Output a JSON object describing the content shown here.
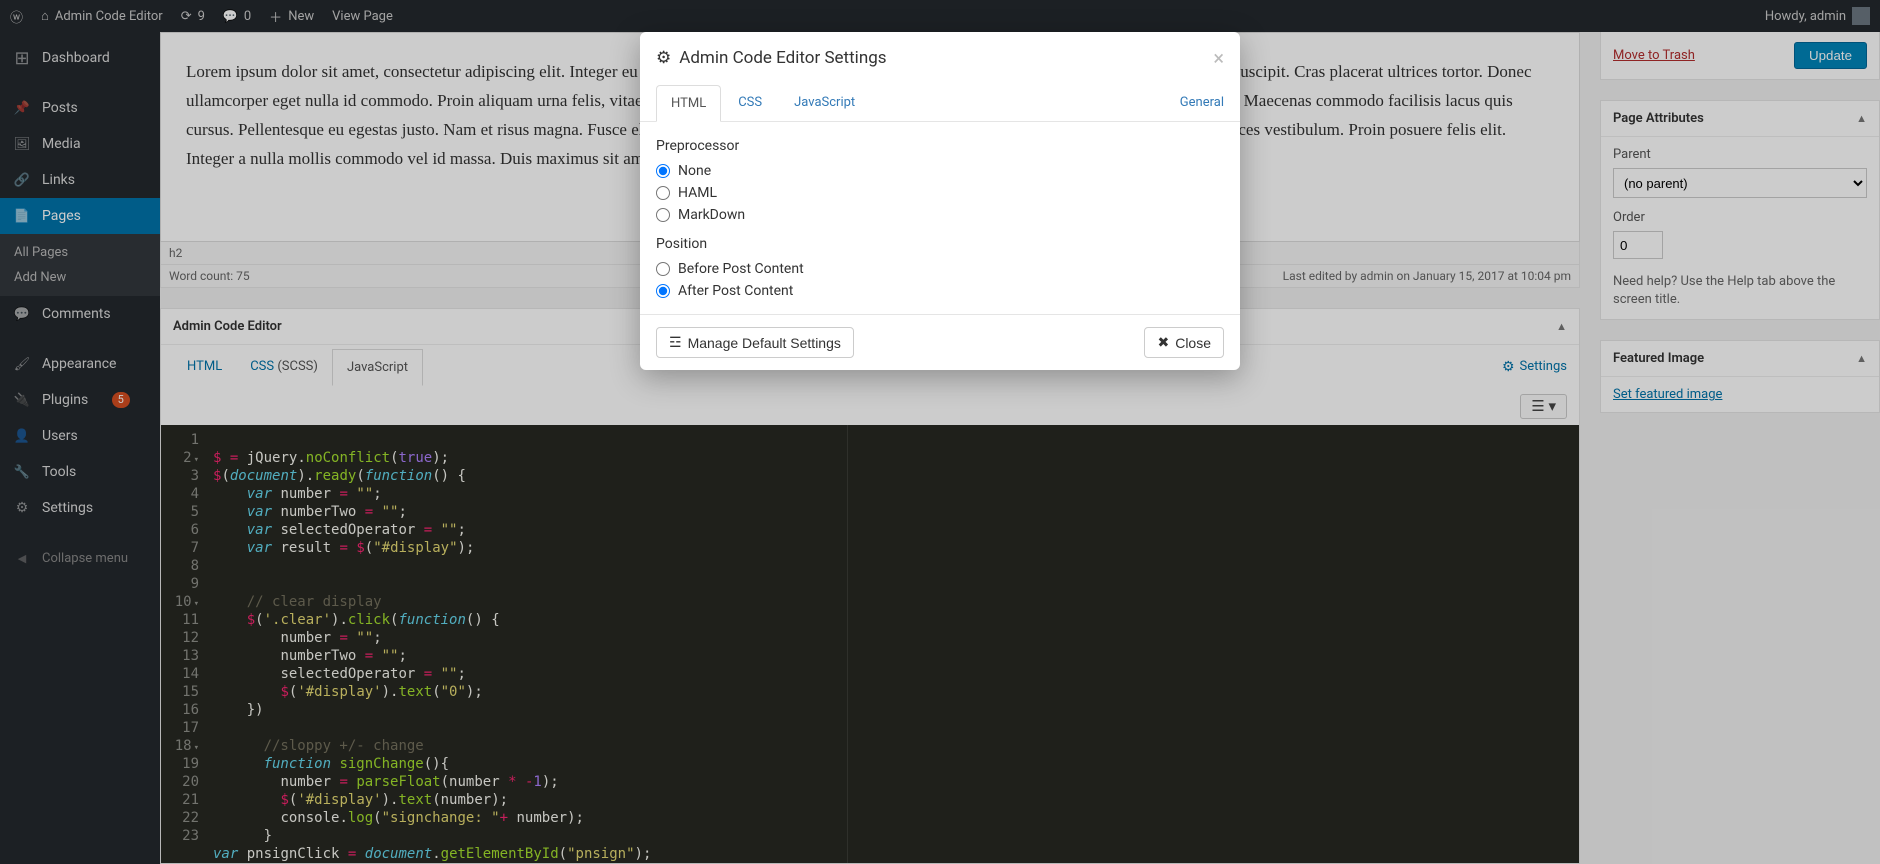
{
  "adminbar": {
    "site_title": "Admin Code Editor",
    "updates_count": "9",
    "comments_count": "0",
    "new_label": "New",
    "view_page_label": "View Page",
    "howdy": "Howdy, admin"
  },
  "sidemenu": {
    "dashboard": "Dashboard",
    "posts": "Posts",
    "media": "Media",
    "links": "Links",
    "pages": "Pages",
    "pages_sub_all": "All Pages",
    "pages_sub_add": "Add New",
    "comments": "Comments",
    "appearance": "Appearance",
    "plugins": "Plugins",
    "plugins_badge": "5",
    "users": "Users",
    "tools": "Tools",
    "settings": "Settings",
    "collapse": "Collapse menu"
  },
  "editor": {
    "body_text": "Lorem ipsum dolor sit amet, consectetur adipiscing elit. Integer eu egestas odio. Suspendisse dictum tortor scelerisque justo egestas, quis hendrerit ipsum suscipit. Cras placerat ultrices tortor. Donec ullamcorper eget nulla id commodo. Proin aliquam urna felis, vitae lacinia velit accumsan ac. Vestibulum velit vitae lectus convallis dignissim vel et dolor. Maecenas commodo facilisis lacus quis cursus. Pellentesque eu egestas justo. Nam et risus magna. Fusce elementum ipsum suscipit pretium dapibus. Ut auctor bibendum orci, in sodales sem ultrices vestibulum. Proin posuere felis elit. Integer a nulla mollis commodo vel id massa. Duis maximus sit amet mauris id sollicitudin.",
    "path_info": "h2",
    "word_count_label": "Word count: 75",
    "last_edit": "Last edited by admin on January 15, 2017 at 10:04 pm"
  },
  "ace": {
    "panel_title": "Admin Code Editor",
    "tab_html": "HTML",
    "tab_css_full": "CSS (SCSS)",
    "tab_css_label": "CSS",
    "tab_css_paren": " (SCSS)",
    "tab_js": "JavaScript",
    "settings_link": "Settings"
  },
  "code_lines": [
    "1",
    "2",
    "3",
    "4",
    "5",
    "6",
    "7",
    "8",
    "9",
    "10",
    "11",
    "12",
    "13",
    "14",
    "15",
    "16",
    "17",
    "18",
    "19",
    "20",
    "21",
    "22",
    "23"
  ],
  "right": {
    "trash": "Move to Trash",
    "update": "Update",
    "attrs_title": "Page Attributes",
    "parent_label": "Parent",
    "parent_value": "(no parent)",
    "order_label": "Order",
    "order_value": "0",
    "help_text": "Need help? Use the Help tab above the screen title.",
    "featured_title": "Featured Image",
    "featured_link": "Set featured image"
  },
  "modal": {
    "title": "Admin Code Editor Settings",
    "tab_html": "HTML",
    "tab_css": "CSS",
    "tab_js": "JavaScript",
    "tab_general": "General",
    "preprocessor_label": "Preprocessor",
    "pp_none": "None",
    "pp_haml": "HAML",
    "pp_md": "MarkDown",
    "position_label": "Position",
    "pos_before": "Before Post Content",
    "pos_after": "After Post Content",
    "manage_defaults": "Manage Default Settings",
    "close": "Close"
  }
}
